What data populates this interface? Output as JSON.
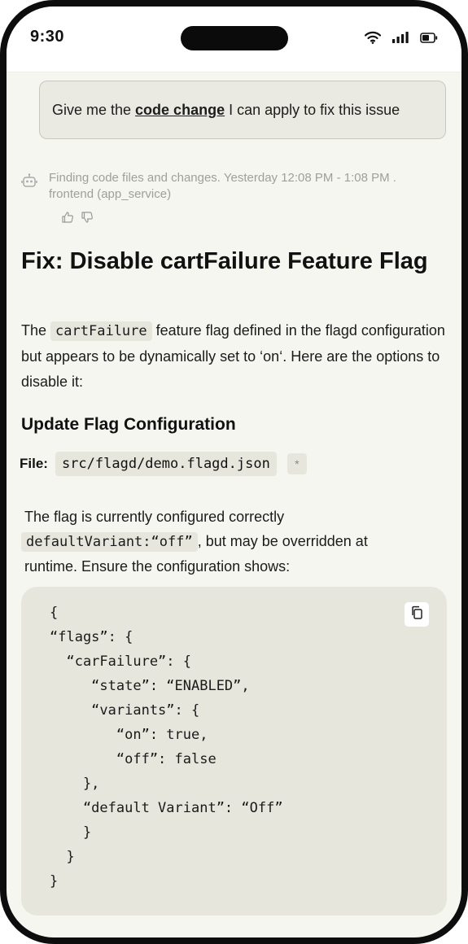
{
  "status_bar": {
    "time": "9:30",
    "icons": [
      "wifi-icon",
      "cellular-signal-icon",
      "battery-icon"
    ]
  },
  "user_message": {
    "before": "Give me the",
    "link": "code change",
    "after": "I can apply to fix this issue"
  },
  "agent_meta": {
    "icon": "bot-icon",
    "line1": "Finding code files and changes. Yesterday 12:08 PM - 1:08 PM .",
    "line2": "frontend (app_service)",
    "feedback_icons": [
      "thumbs-up-icon",
      "thumbs-down-icon"
    ]
  },
  "response": {
    "title": "Fix: Disable cartFailure Feature Flag",
    "intro_before": "The",
    "intro_code": "cartFailure",
    "intro_after": "feature flag defined in the flagd configuration but appears to be dynamically set to ‘on‘. Here are the options to disable it:",
    "section_title": "Update Flag Configuration",
    "file_label": "File:",
    "file_path": "src/flagd/demo.flagd.json",
    "file_marker": "*",
    "para2_line1": "The flag  is currently configured correctly",
    "para2_code": "defaultVariant:“off”",
    "para2_line2_after": ",   but may be overridden at",
    "para2_line3": "runtime. Ensure the configuration shows:",
    "code_block": "{\n“flags”: {\n  “carFailure”: {\n     “state”: “ENABLED”,\n     “variants”: {\n        “on”: true,\n        “off”: false\n    },\n    “default Variant”: “Off”\n    }\n  }\n}",
    "copy_icon": "copy-icon"
  },
  "colors": {
    "background": "#f6f6f1",
    "bubble": "#eaeae2",
    "code_bg": "#e6e6dc",
    "meta_text": "#a0a09a"
  }
}
